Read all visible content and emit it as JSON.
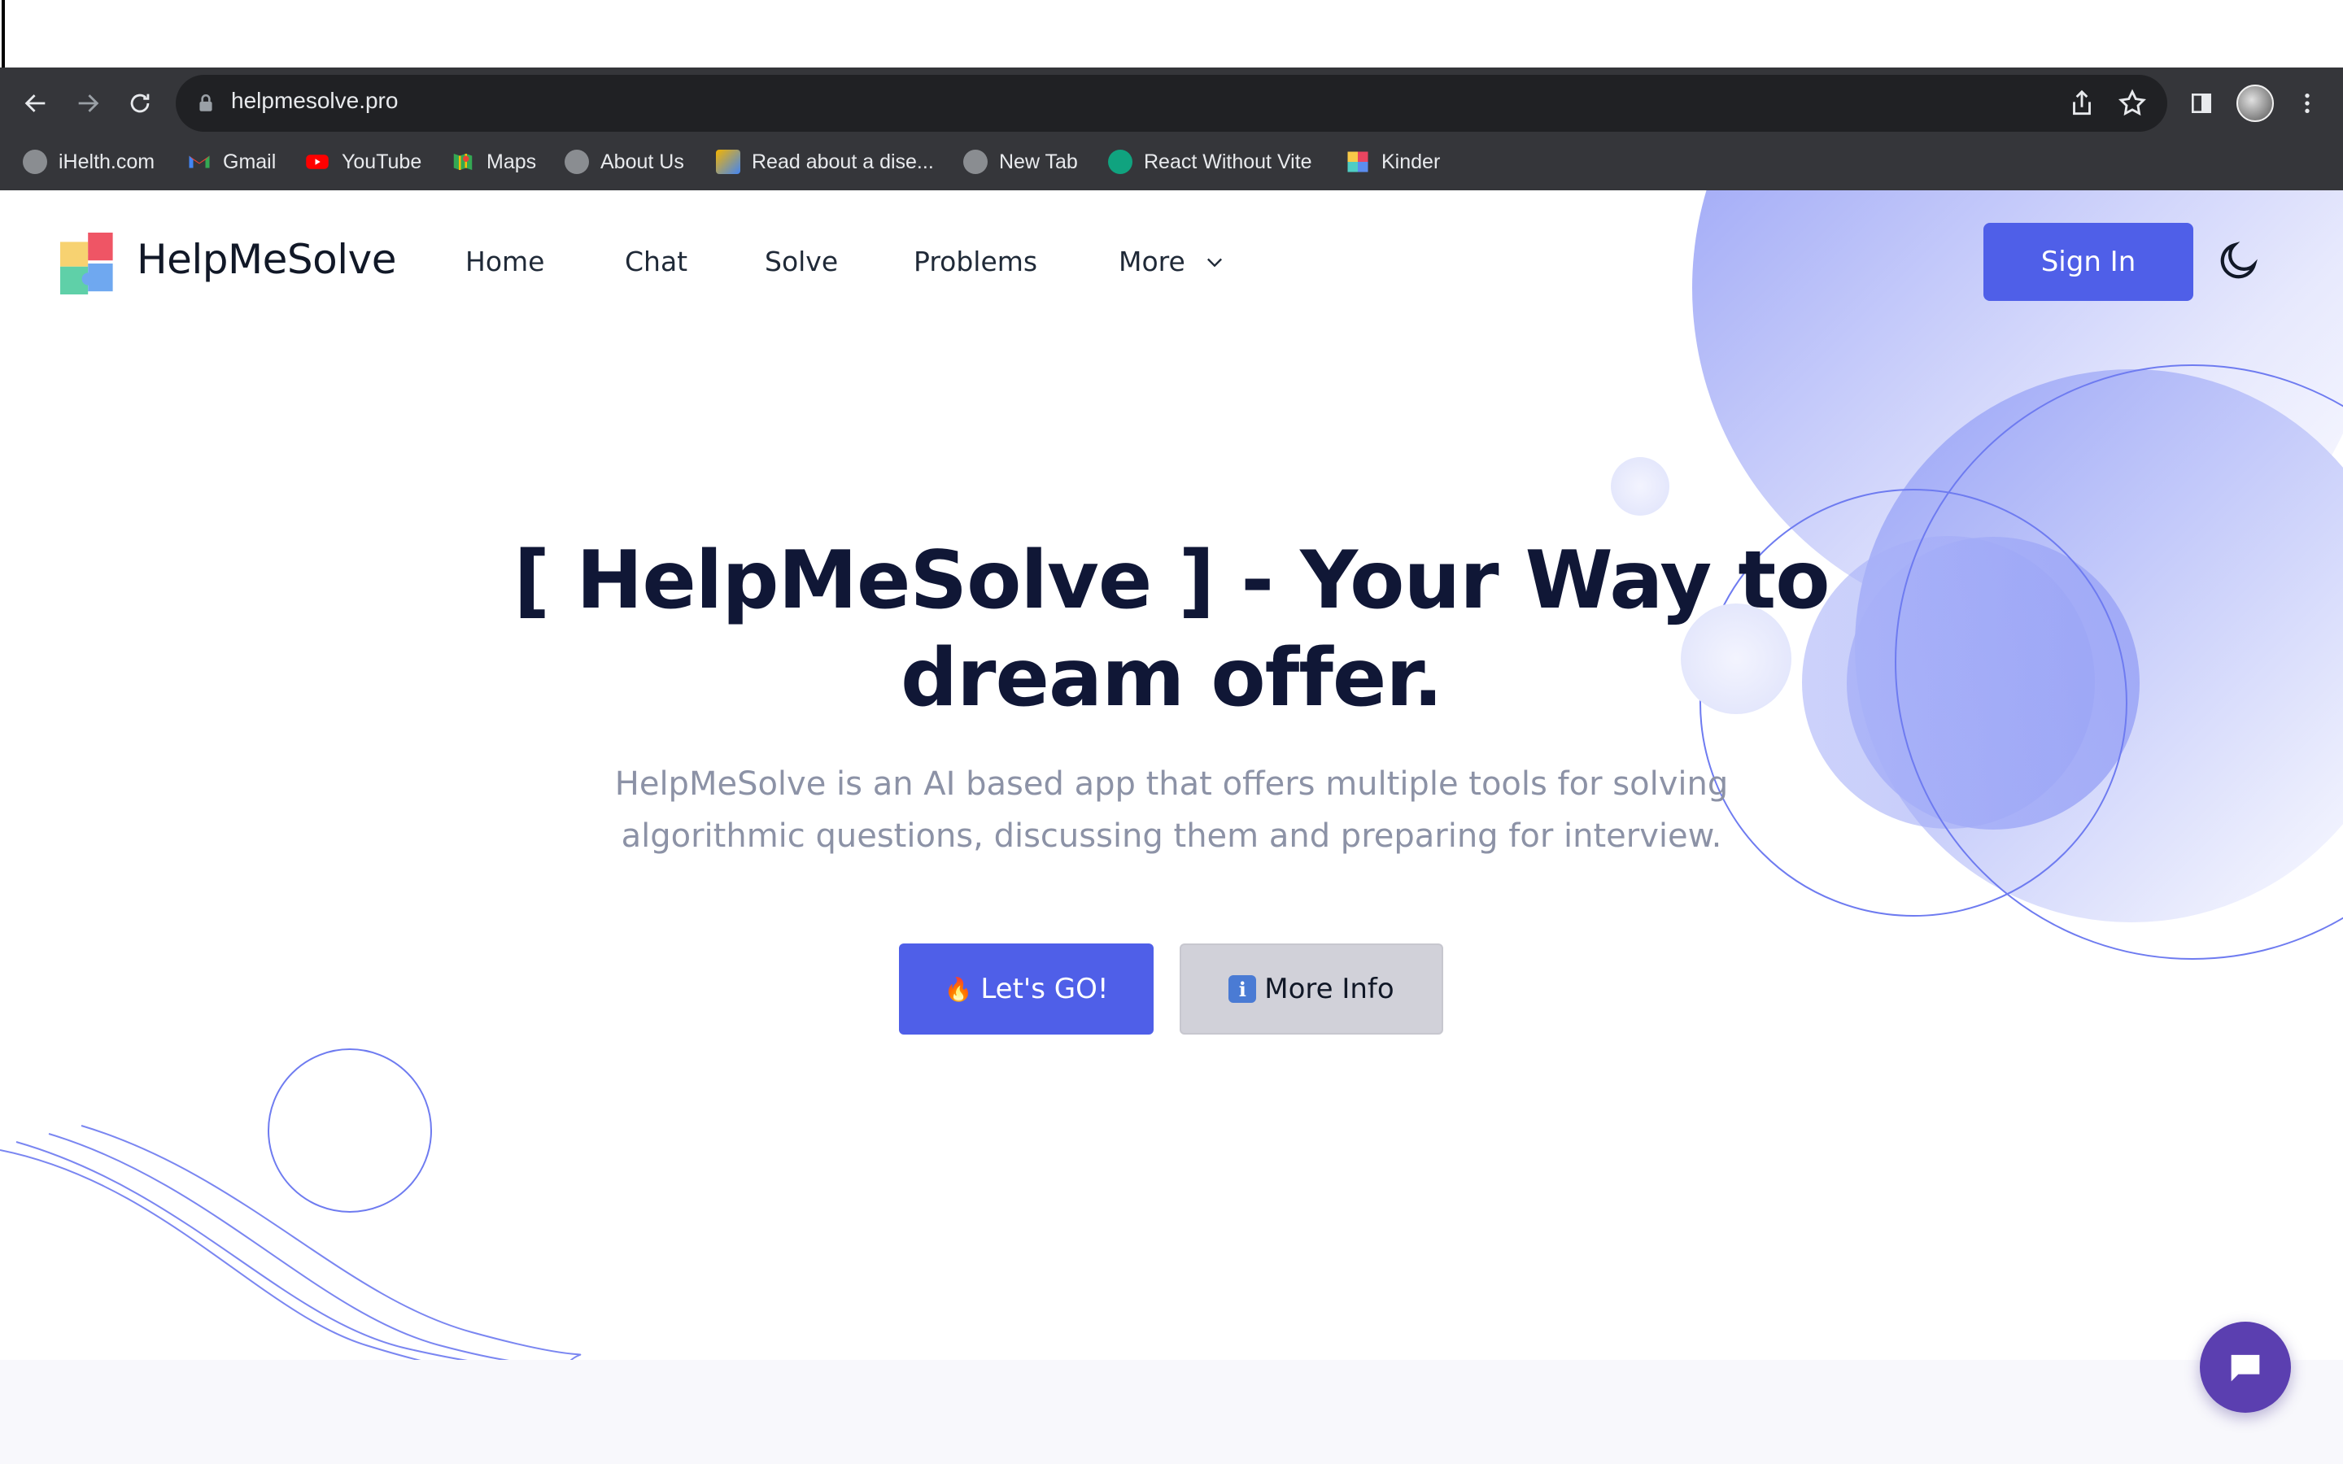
{
  "browser": {
    "url": "helpmesolve.pro",
    "bookmarks": [
      {
        "label": "iHelth.com",
        "icon": "globe-icon"
      },
      {
        "label": "Gmail",
        "icon": "gmail-icon"
      },
      {
        "label": "YouTube",
        "icon": "youtube-icon"
      },
      {
        "label": "Maps",
        "icon": "maps-icon"
      },
      {
        "label": "About Us",
        "icon": "globe-icon"
      },
      {
        "label": "Read about a dise...",
        "icon": "bookmark-favicon-icon"
      },
      {
        "label": "New Tab",
        "icon": "globe-icon"
      },
      {
        "label": "React Without Vite",
        "icon": "openai-icon"
      },
      {
        "label": "Kinder",
        "icon": "puzzle-favicon-icon"
      }
    ]
  },
  "header": {
    "brand": "HelpMeSolve",
    "nav": {
      "home": "Home",
      "chat": "Chat",
      "solve": "Solve",
      "problems": "Problems",
      "more": "More"
    },
    "sign_in": "Sign In"
  },
  "hero": {
    "title_line1": "[ HelpMeSolve ] - Your Way to",
    "title_line2": "dream offer.",
    "subtitle_line1": "HelpMeSolve is an AI based app that offers multiple tools for solving",
    "subtitle_line2": "algorithmic questions, discussing them and preparing for interview.",
    "primary_button": "Let's GO!",
    "primary_emoji": "🔥",
    "secondary_button": "More Info",
    "secondary_glyph": "i"
  },
  "colors": {
    "accent": "#4f5fe8",
    "title": "#101736",
    "subtitle": "#8c92a6",
    "chat_fab": "#5b3fb0"
  }
}
